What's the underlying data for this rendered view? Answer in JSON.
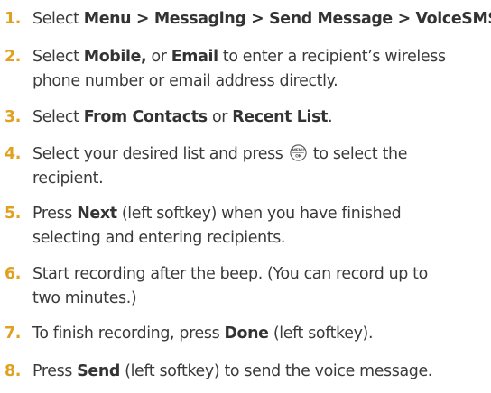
{
  "steps": [
    {
      "num": "1.",
      "lines": [
        [
          {
            "t": "Select "
          },
          {
            "t": "Menu > Messaging > Send Message > VoiceSMS",
            "b": true
          },
          {
            "t": "."
          }
        ]
      ]
    },
    {
      "num": "2.",
      "lines": [
        [
          {
            "t": "Select "
          },
          {
            "t": "Mobile,",
            "b": true
          },
          {
            "t": " or "
          },
          {
            "t": "Email",
            "b": true
          },
          {
            "t": " to enter a recipient’s wireless"
          }
        ],
        [
          {
            "t": "phone number or email address directly."
          }
        ]
      ]
    },
    {
      "num": "3.",
      "lines": [
        [
          {
            "t": "Select "
          },
          {
            "t": "From Contacts",
            "b": true
          },
          {
            "t": " or "
          },
          {
            "t": "Recent List",
            "b": true
          },
          {
            "t": "."
          }
        ]
      ]
    },
    {
      "num": "4.",
      "lines": [
        [
          {
            "t": "Select your desired list and press "
          },
          {
            "icon": "menu-ok-key-icon",
            "label_top": "MENU",
            "label_bottom": "OK"
          },
          {
            "t": " to select the"
          }
        ],
        [
          {
            "t": "recipient."
          }
        ]
      ]
    },
    {
      "num": "5.",
      "lines": [
        [
          {
            "t": "Press "
          },
          {
            "t": "Next",
            "b": true
          },
          {
            "t": " (left softkey) when you have finished"
          }
        ],
        [
          {
            "t": "selecting and entering recipients."
          }
        ]
      ]
    },
    {
      "num": "6.",
      "lines": [
        [
          {
            "t": "Start recording after the beep. (You can record up to"
          }
        ],
        [
          {
            "t": "two minutes.)"
          }
        ]
      ]
    },
    {
      "num": "7.",
      "lines": [
        [
          {
            "t": "To finish recording, press "
          },
          {
            "t": "Done",
            "b": true
          },
          {
            "t": " (left softkey)."
          }
        ]
      ]
    },
    {
      "num": "8.",
      "lines": [
        [
          {
            "t": "Press "
          },
          {
            "t": "Send",
            "b": true
          },
          {
            "t": " (left softkey) to send the voice message."
          }
        ]
      ]
    }
  ],
  "colors": {
    "number": "#e0a020",
    "text": "#3a3a3a",
    "icon_stroke": "#555555"
  }
}
